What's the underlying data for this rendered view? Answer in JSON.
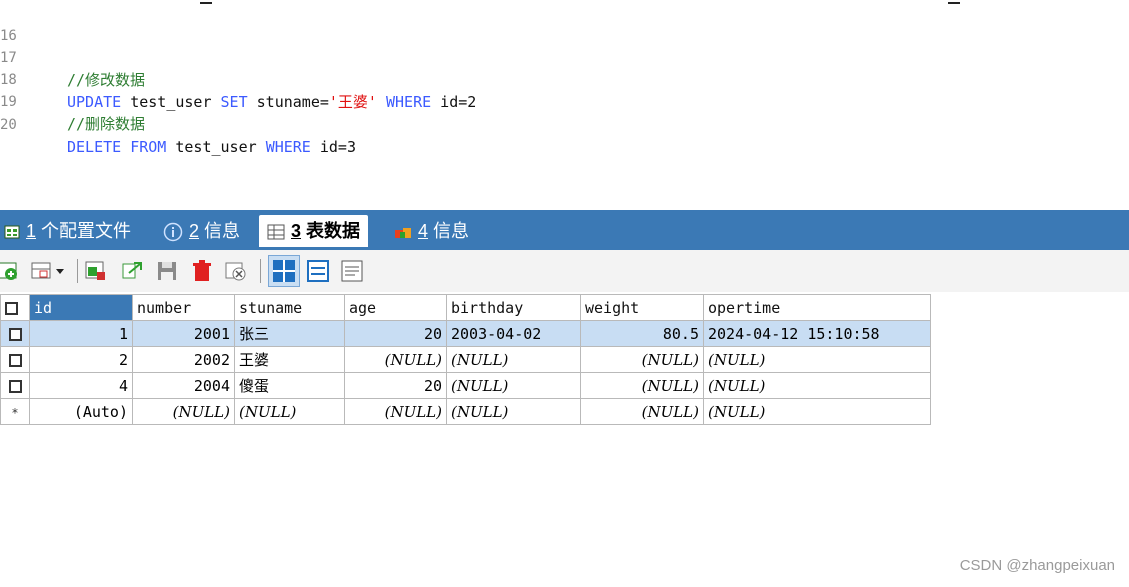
{
  "editor": {
    "lines": [
      {
        "n": "16",
        "parts": []
      },
      {
        "n": "17",
        "parts": [
          {
            "t": "//修改数据",
            "c": "cmt"
          }
        ]
      },
      {
        "n": "18",
        "parts": [
          {
            "t": "UPDATE",
            "c": "kw"
          },
          {
            "t": " test_user ",
            "c": "plain"
          },
          {
            "t": "SET",
            "c": "kw"
          },
          {
            "t": " stuname=",
            "c": "plain"
          },
          {
            "t": "'王婆'",
            "c": "str"
          },
          {
            "t": " ",
            "c": "plain"
          },
          {
            "t": "WHERE",
            "c": "kw"
          },
          {
            "t": " id=2",
            "c": "plain"
          }
        ]
      },
      {
        "n": "19",
        "parts": [
          {
            "t": "//删除数据",
            "c": "cmt"
          }
        ]
      },
      {
        "n": "20",
        "parts": [
          {
            "t": "DELETE",
            "c": "kw"
          },
          {
            "t": " ",
            "c": "plain"
          },
          {
            "t": "FROM",
            "c": "kw"
          },
          {
            "t": " test_user ",
            "c": "plain"
          },
          {
            "t": "WHERE",
            "c": "kw"
          },
          {
            "t": " id=3",
            "c": "plain"
          }
        ]
      }
    ]
  },
  "tabs": [
    {
      "num": "1",
      "label": " 个配置文件",
      "icon": "profile-icon",
      "active": false
    },
    {
      "num": "2",
      "label": " 信息",
      "icon": "info-icon",
      "active": false
    },
    {
      "num": "3",
      "label": " 表数据",
      "icon": "table-icon",
      "active": true
    },
    {
      "num": "4",
      "label": " 信息",
      "icon": "info-cube-icon",
      "active": false
    }
  ],
  "toolbar": {
    "icons": [
      "add-row-icon",
      "insert-row-dropdown-icon",
      "duplicate-row-icon",
      "refresh-icon",
      "save-icon",
      "delete-icon",
      "cancel-icon",
      "grid-view-icon",
      "form-view-icon",
      "text-view-icon"
    ]
  },
  "grid": {
    "columns": [
      "id",
      "number",
      "stuname",
      "age",
      "birthday",
      "weight",
      "opertime"
    ],
    "rows": [
      {
        "mark": "",
        "selected": true,
        "cells": [
          "1",
          "2001",
          "张三",
          "20",
          "2003-04-02",
          "80.5",
          "2024-04-12 15:10:58"
        ]
      },
      {
        "mark": "",
        "selected": false,
        "cells": [
          "2",
          "2002",
          "王婆",
          "(NULL)",
          "(NULL)",
          "(NULL)",
          "(NULL)"
        ]
      },
      {
        "mark": "",
        "selected": false,
        "cells": [
          "4",
          "2004",
          "傻蛋",
          "20",
          "(NULL)",
          "(NULL)",
          "(NULL)"
        ]
      },
      {
        "mark": "*",
        "selected": false,
        "cells": [
          "(Auto)",
          "(NULL)",
          "(NULL)",
          "(NULL)",
          "(NULL)",
          "(NULL)",
          "(NULL)"
        ]
      }
    ]
  },
  "watermark": "CSDN @zhangpeixuan",
  "colors": {
    "tab_bar": "#3b79b5",
    "selected_row": "#c8ddf3",
    "keyword": "#3c5aff",
    "comment": "#2e7d32",
    "string": "#e01010"
  }
}
